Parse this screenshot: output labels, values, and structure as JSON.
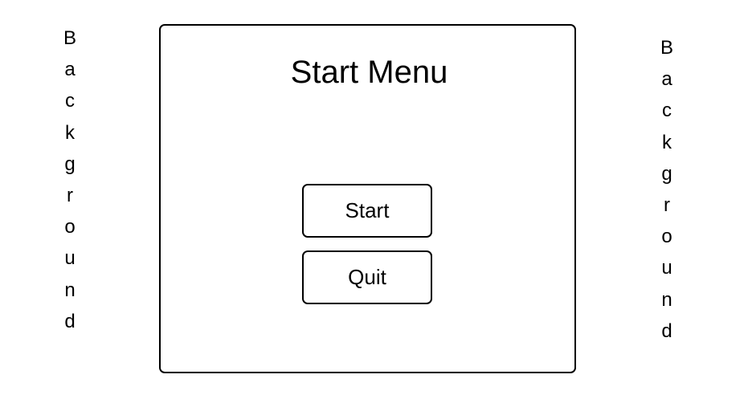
{
  "background": {
    "left_letters": [
      "B",
      "a",
      "c",
      "k",
      "g",
      "r",
      "o",
      "u",
      "n",
      "d"
    ],
    "right_letters": [
      "B",
      "a",
      "c",
      "k",
      "g",
      "r",
      "o",
      "u",
      "n",
      "d"
    ]
  },
  "menu": {
    "title": "Start Menu",
    "start_label": "Start",
    "quit_label": "Quit"
  }
}
